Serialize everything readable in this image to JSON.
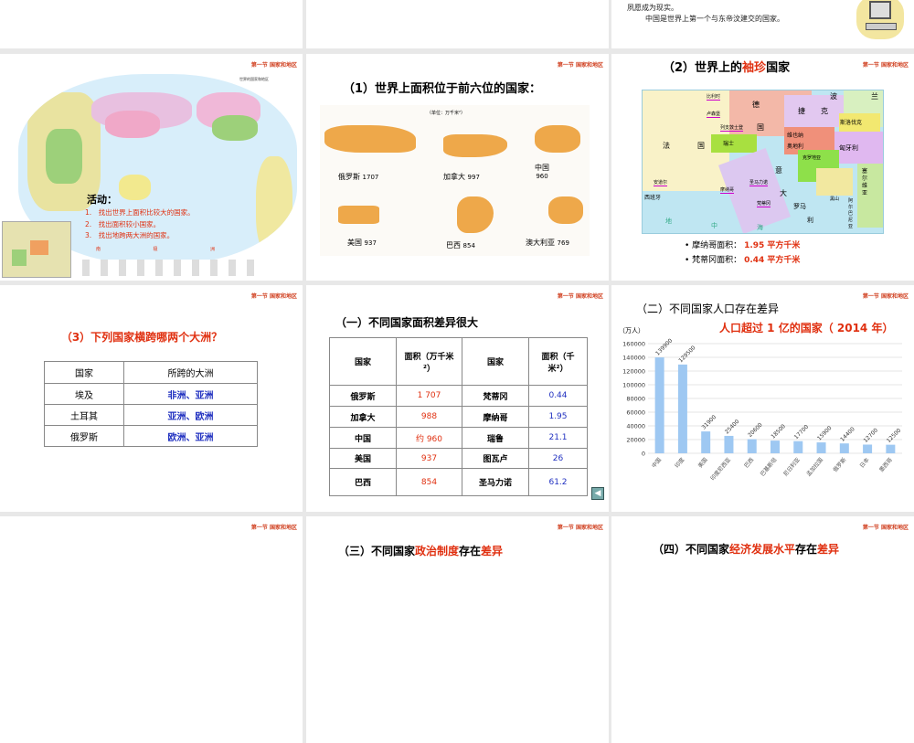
{
  "common": {
    "section_header": "第一节 国家和地区"
  },
  "top_row": {
    "slide3": {
      "line1": "夙愿成为现实。",
      "line2": "中国是世界上第一个与东帝汶建交的国家。"
    }
  },
  "slide_map": {
    "map_title": "世界的国家和地区",
    "activity_title": "活动：",
    "items": [
      "1.　找出世界上面积比较大的国家。",
      "2.　找出面积较小国家。",
      "3.　找出地跨两大洲的国家。"
    ],
    "ocean_labels": [
      "南",
      "极",
      "洲"
    ]
  },
  "slide_area": {
    "title": "（1）世界上面积位于前六位的国家：",
    "unit": "（单位：万千米²）",
    "countries": [
      {
        "name": "俄罗斯",
        "value": "1707"
      },
      {
        "name": "加拿大",
        "value": "997"
      },
      {
        "name": "中国",
        "value": "960"
      },
      {
        "name": "美国",
        "value": "937"
      },
      {
        "name": "巴西",
        "value": "854"
      },
      {
        "name": "澳大利亚",
        "value": "769"
      }
    ]
  },
  "slide_micro": {
    "title_a": "（2）世界上的",
    "title_b": "袖珍",
    "title_c": "国家",
    "map_labels": [
      "比利时",
      "卢森堡",
      "列支敦士登",
      "德",
      "国",
      "波",
      "兰",
      "捷",
      "克",
      "斯洛伐克",
      "维也纳",
      "奥地利",
      "匈牙利",
      "瑞士",
      "法",
      "国",
      "意",
      "大",
      "罗马",
      "利",
      "摩纳哥",
      "圣马力诺",
      "梵蒂冈",
      "安道尔",
      "西班牙",
      "地",
      "中",
      "海",
      "克罗地亚",
      "塞尔维亚",
      "黑山",
      "阿尔巴尼亚"
    ],
    "bullets": [
      {
        "label": "摩纳哥面积：",
        "value": "1.95 平方千米"
      },
      {
        "label": "梵蒂冈面积：",
        "value": "0.44 平方千米"
      }
    ]
  },
  "slide_cross": {
    "title": "（3）下列国家横跨哪两个大洲？",
    "headers": [
      "国家",
      "所跨的大洲"
    ],
    "rows": [
      [
        "埃及",
        "非洲、亚洲"
      ],
      [
        "土耳其",
        "亚洲、欧洲"
      ],
      [
        "俄罗斯",
        "欧洲、亚洲"
      ]
    ]
  },
  "slide_table": {
    "title": "（一）不同国家面积差异很大",
    "headers": [
      "国家",
      "面积（万千米²）",
      "国家",
      "面积（千米²）"
    ],
    "rows": [
      [
        "俄罗斯",
        "1 707",
        "梵蒂冈",
        "0.44"
      ],
      [
        "加拿大",
        "988",
        "摩纳哥",
        "1.95"
      ],
      [
        "中国",
        "约 960",
        "瑞鲁",
        "21.1"
      ],
      [
        "美国",
        "937",
        "图瓦卢",
        "26"
      ],
      [
        "巴西",
        "854",
        "圣马力诺",
        "61.2"
      ]
    ],
    "back_icon": "triangle-left"
  },
  "slide_pop": {
    "title": "（二）不同国家人口存在差异",
    "subtitle": "人口超过 1 亿的国家（ 2014 年）"
  },
  "chart_data": {
    "type": "bar",
    "title": "人口超过 1 亿的国家（ 2014 年）",
    "ylabel": "（万人）",
    "ylim": [
      0,
      160000
    ],
    "yticks": [
      "0",
      "20000",
      "40000",
      "60000",
      "80000",
      "100000",
      "120000",
      "140000",
      "160000"
    ],
    "categories": [
      "中国",
      "印度",
      "美国",
      "印度尼西亚",
      "巴西",
      "巴基斯坦",
      "尼日利亚",
      "孟加拉国",
      "俄罗斯",
      "日本",
      "墨西哥"
    ],
    "values": [
      139900,
      129500,
      31900,
      25400,
      20600,
      18500,
      17700,
      15900,
      14400,
      12700,
      12500
    ],
    "value_labels": [
      "139900",
      "129500",
      "31900",
      "25400",
      "20600",
      "18500",
      "17700",
      "15900",
      "14400",
      "12700",
      "12500"
    ],
    "bar_color": "#9ec8f2",
    "grid": true
  },
  "bottom_row": {
    "slide2_title_a": "（三）不同国家",
    "slide2_title_b": "政治制度",
    "slide2_title_c": "存在",
    "slide2_title_d": "差异",
    "slide3_title_a": "（四）不同国家",
    "slide3_title_b": "经济发展水平",
    "slide3_title_c": "存在",
    "slide3_title_d": "差异"
  }
}
